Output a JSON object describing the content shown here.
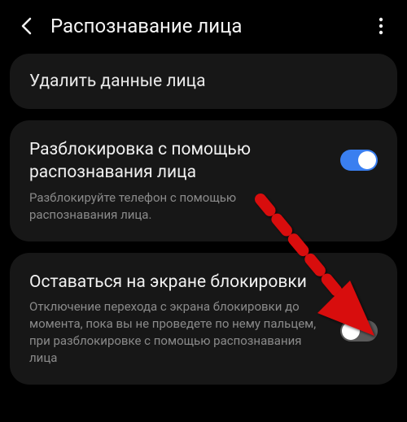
{
  "header": {
    "title": "Распознавание лица"
  },
  "actions": {
    "delete_face_data": "Удалить данные лица"
  },
  "settings": {
    "face_unlock": {
      "title": "Разблокировка с помощью распознавания лица",
      "desc": "Разблокируйте телефон с помощью распознавания лица.",
      "state": "on"
    },
    "stay_on_lock": {
      "title": "Оставаться на экране блокировки",
      "desc": "Отключение перехода с экрана блокировки до момента, пока вы не проведете по нему пальцем, при разблокировке с помощью распознавания лица",
      "state": "off"
    }
  },
  "colors": {
    "accent": "#3a7ff0",
    "annotation": "#d8090d"
  }
}
